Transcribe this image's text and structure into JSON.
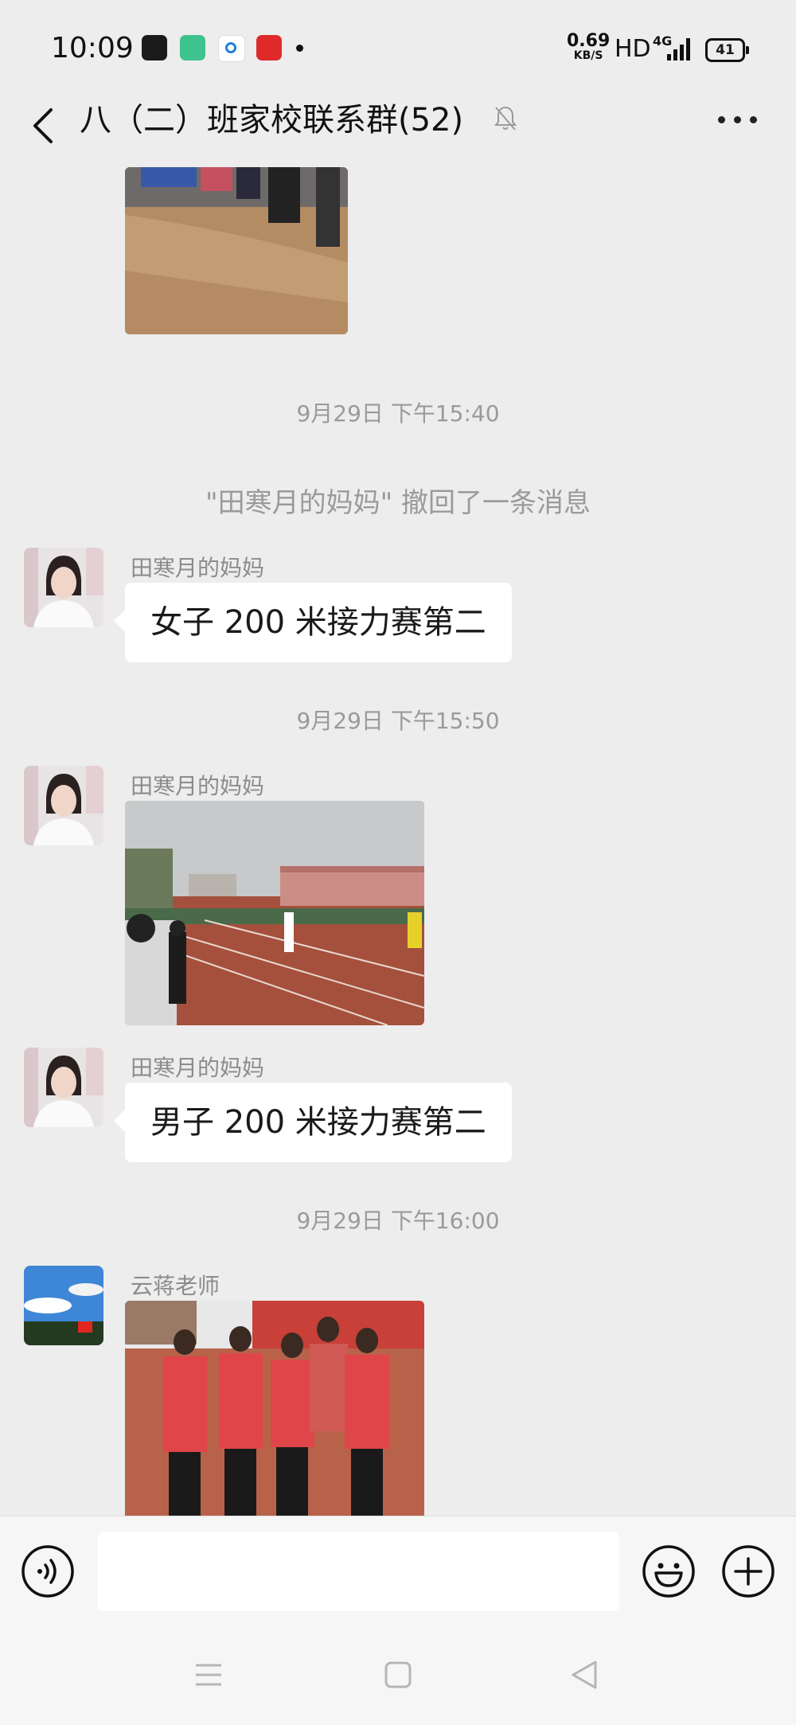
{
  "status_bar": {
    "time": "10:09",
    "speed_value": "0.69",
    "speed_unit": "KB/S",
    "hd": "HD",
    "network": "4G",
    "battery": "41"
  },
  "header": {
    "title": "八（二）班家校联系群(52)",
    "back_icon": "chevron-left-icon",
    "mute_icon": "bell-off-icon",
    "more_icon": "more-dots-icon"
  },
  "messages": {
    "ts1": "9月29日 下午15:40",
    "recall_notice": "\"田寒月的妈妈\" 撤回了一条消息",
    "msg1_sender": "田寒月的妈妈",
    "msg1_text": "女子 200 米接力赛第二",
    "ts2": "9月29日 下午15:50",
    "msg2_sender": "田寒月的妈妈",
    "msg3_sender": "田寒月的妈妈",
    "msg3_text": "男子 200 米接力赛第二",
    "ts3": "9月29日 下午16:00",
    "msg4_sender": "云蒋老师"
  },
  "input_bar": {
    "value": "",
    "voice_icon": "voice-icon",
    "emoji_icon": "emoji-icon",
    "plus_icon": "plus-icon"
  },
  "nav_bar": {
    "menu_icon": "menu-icon",
    "home_icon": "home-icon",
    "back_icon": "back-triangle-icon"
  },
  "colors": {
    "background": "#ededed",
    "bubble": "#ffffff",
    "meta_text": "#9a9a9a"
  }
}
